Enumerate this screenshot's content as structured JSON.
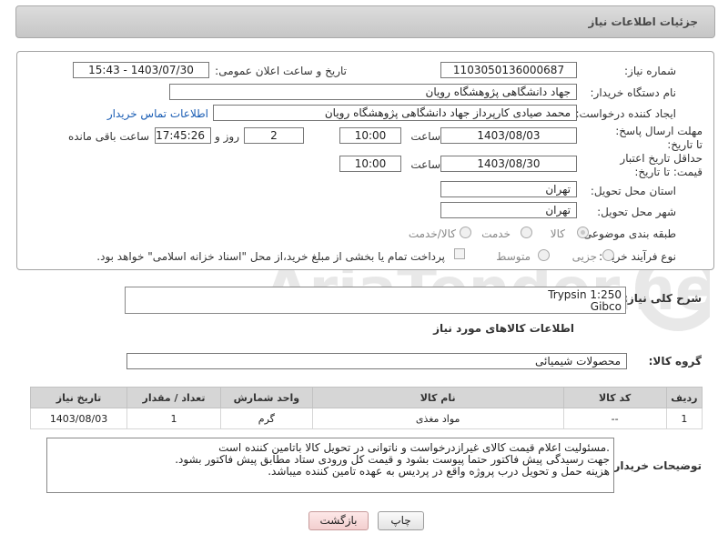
{
  "header": {
    "title": "جزئیات اطلاعات نیاز"
  },
  "form": {
    "need_number": {
      "label": "شماره نیاز:",
      "value": "1103050136000687"
    },
    "announce_datetime": {
      "label": "تاریخ و ساعت اعلان عمومی:",
      "value": "1403/07/30 - 15:43"
    },
    "buyer_org": {
      "label": "نام دستگاه خریدار:",
      "value": "جهاد دانشگاهی پژوهشگاه رویان"
    },
    "creator": {
      "label": "ایجاد کننده درخواست:",
      "value": "محمد صیادی کارپرداز جهاد دانشگاهی پژوهشگاه رویان",
      "contact_link": "اطلاعات تماس خریدار"
    },
    "reply_deadline": {
      "label": "مهلت ارسال پاسخ: تا تاریخ:",
      "date": "1403/08/03",
      "time_label": "ساعت",
      "time": "10:00",
      "days": "2",
      "days_label": "روز و",
      "remaining": "17:45:26",
      "remaining_label": "ساعت باقی مانده"
    },
    "price_deadline": {
      "label": "حداقل تاریخ اعتبار قیمت: تا تاریخ:",
      "date": "1403/08/30",
      "time_label": "ساعت",
      "time": "10:00"
    },
    "province": {
      "label": "استان محل تحویل:",
      "value": "تهران"
    },
    "city": {
      "label": "شهر محل تحویل:",
      "value": "تهران"
    },
    "category": {
      "label": "طبقه بندی موضوعی:",
      "options": [
        "کالا",
        "خدمت",
        "کالا/خدمت"
      ],
      "selected": "کالا"
    },
    "purchase_type": {
      "label": "نوع فرآیند خرید :",
      "options": [
        "جزیی",
        "متوسط"
      ],
      "note": "پرداخت تمام یا بخشی از مبلغ خرید،از محل \"اسناد خزانه اسلامی\" خواهد بود."
    }
  },
  "description": {
    "label": "شرح کلی نیاز:",
    "value": "Trypsin 1:250\nGibco"
  },
  "goods_section": {
    "title": "اطلاعات کالاهای مورد نیاز",
    "group_label": "گروه کالا:",
    "group_value": "محصولات شیمیائی",
    "columns": [
      "ردیف",
      "کد کالا",
      "نام کالا",
      "واحد شمارش",
      "تعداد / مقدار",
      "تاریخ نیاز"
    ],
    "rows": [
      {
        "row": "1",
        "code": "--",
        "name": "مواد مغذی",
        "unit": "گرم",
        "qty": "1",
        "date": "1403/08/03"
      }
    ]
  },
  "buyer_notes": {
    "label": "توضیحات خریدار:",
    "lines": [
      ".مسئولیت اعلام قیمت کالای غیرازدرخواست و ناتوانی در تحویل کالا باتامین کننده است",
      "جهت رسیدگی پیش فاکتور حتما پیوست بشود و قیمت کل ورودی ستاد مطابق پیش فاکتور بشود.",
      "هزینه حمل و تحویل درب پروژه واقع در پردیس به عهده تامین کننده میباشد."
    ]
  },
  "buttons": {
    "print": "چاپ",
    "back": "بازگشت"
  },
  "watermark": {
    "text": "AriaTender.neT"
  },
  "colors": {
    "link": "#1a5db4",
    "table_header": "#d6d6d6",
    "back_button": "#f3cfcf"
  }
}
